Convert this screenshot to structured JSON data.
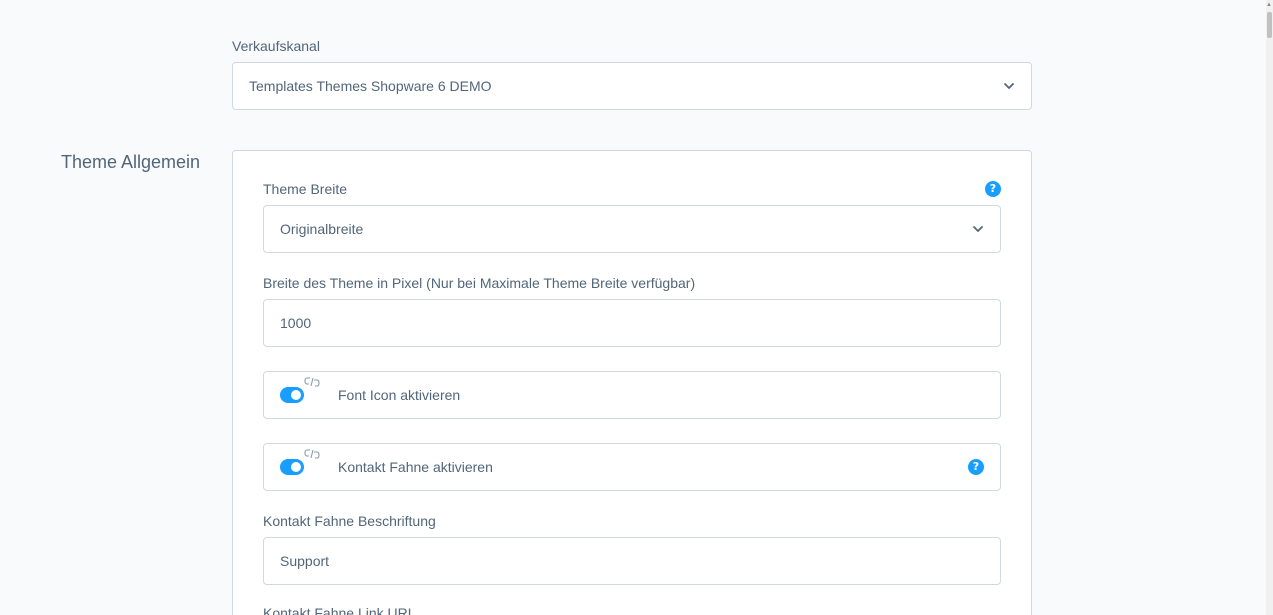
{
  "sales_channel": {
    "label": "Verkaufskanal",
    "value": "Templates Themes Shopware 6 DEMO"
  },
  "section": {
    "title": "Theme Allgemein"
  },
  "fields": {
    "theme_width": {
      "label": "Theme Breite",
      "value": "Originalbreite",
      "help_icon": "question-circle-icon"
    },
    "theme_pixel_width": {
      "label": "Breite des Theme in Pixel (Nur bei Maximale Theme Breite verfügbar)",
      "value": "1000"
    },
    "font_icon": {
      "label": "Font Icon aktivieren",
      "enabled": true
    },
    "contact_flag": {
      "label": "Kontakt Fahne aktivieren",
      "enabled": true,
      "help_icon": "question-circle-icon"
    },
    "contact_flag_caption": {
      "label": "Kontakt Fahne Beschriftung",
      "value": "Support"
    },
    "contact_flag_link": {
      "label": "Kontakt Fahne Link URL"
    }
  },
  "colors": {
    "accent": "#189eff",
    "text": "#52667a",
    "border": "#d1d9e0",
    "background": "#f9fafb"
  }
}
